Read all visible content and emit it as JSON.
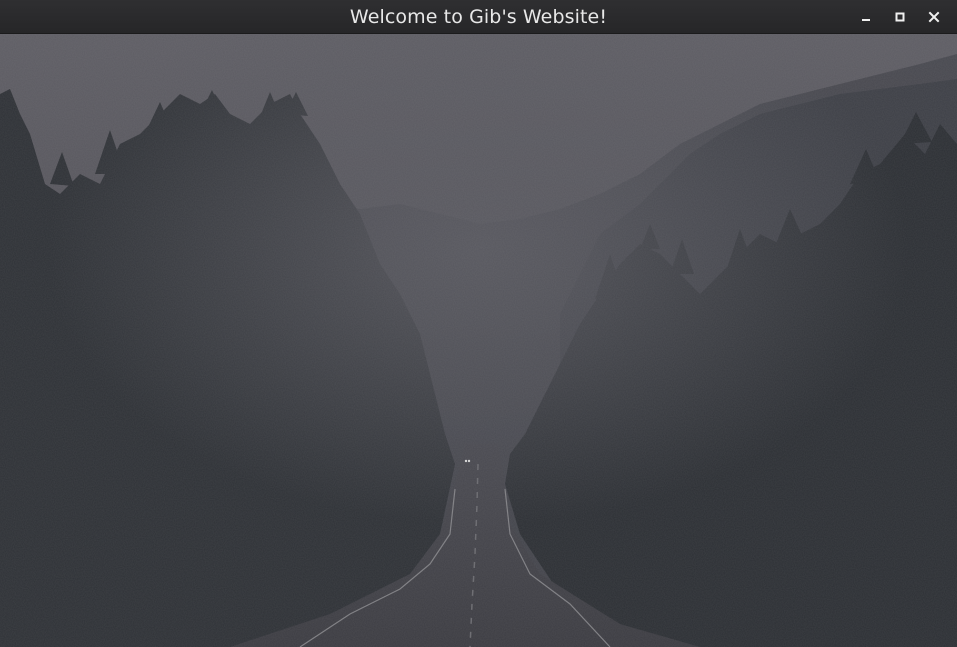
{
  "window": {
    "title": "Welcome to Gib's Website!"
  },
  "controls": {
    "minimize_icon": "minimize-icon",
    "maximize_icon": "maximize-icon",
    "close_icon": "close-icon"
  },
  "background": {
    "description_icon": "misty-forest-road-image",
    "colors": {
      "sky": "#5c5b62",
      "fog": "#4d4d55",
      "trees_near": "#2b2e33",
      "trees_far": "#3a3c43",
      "road": "#3f3f45"
    }
  }
}
